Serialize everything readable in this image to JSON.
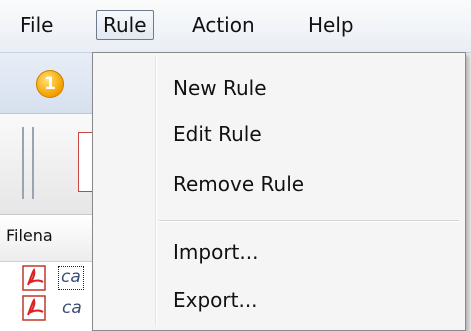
{
  "menubar": {
    "items": [
      {
        "label": "File"
      },
      {
        "label": "Rule"
      },
      {
        "label": "Action"
      },
      {
        "label": "Help"
      }
    ]
  },
  "notification": {
    "count": "1",
    "color": "#f6a500"
  },
  "file_list": {
    "column_header": "Filena",
    "rows": [
      {
        "name": "ca",
        "icon": "pdf-icon"
      },
      {
        "name": "ca",
        "icon": "pdf-icon"
      }
    ]
  },
  "rule_menu": {
    "items": [
      {
        "label": "New Rule"
      },
      {
        "label": "Edit Rule"
      },
      {
        "label": "Remove Rule"
      },
      {
        "label": "Import..."
      },
      {
        "label": "Export..."
      }
    ]
  }
}
